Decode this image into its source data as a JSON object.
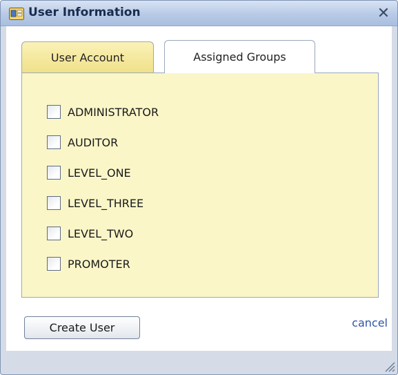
{
  "window": {
    "title": "User Information",
    "close_label": "✕",
    "icon": "user-info-app-icon",
    "close_icon": "close-icon"
  },
  "tabs": [
    {
      "label": "User Account",
      "active": false
    },
    {
      "label": "Assigned Groups",
      "active": true
    }
  ],
  "groups": [
    {
      "label": "ADMINISTRATOR",
      "checked": false
    },
    {
      "label": "AUDITOR",
      "checked": false
    },
    {
      "label": "LEVEL_ONE",
      "checked": false
    },
    {
      "label": "LEVEL_THREE",
      "checked": false
    },
    {
      "label": "LEVEL_TWO",
      "checked": false
    },
    {
      "label": "PROMOTER",
      "checked": false
    }
  ],
  "footer": {
    "create_label": "Create User",
    "cancel_label": "cancel"
  },
  "colors": {
    "panel_bg": "#faf6c8",
    "inactive_tab": "#efe08a",
    "link": "#2d55a6",
    "titlebar": "#b7cae6"
  }
}
